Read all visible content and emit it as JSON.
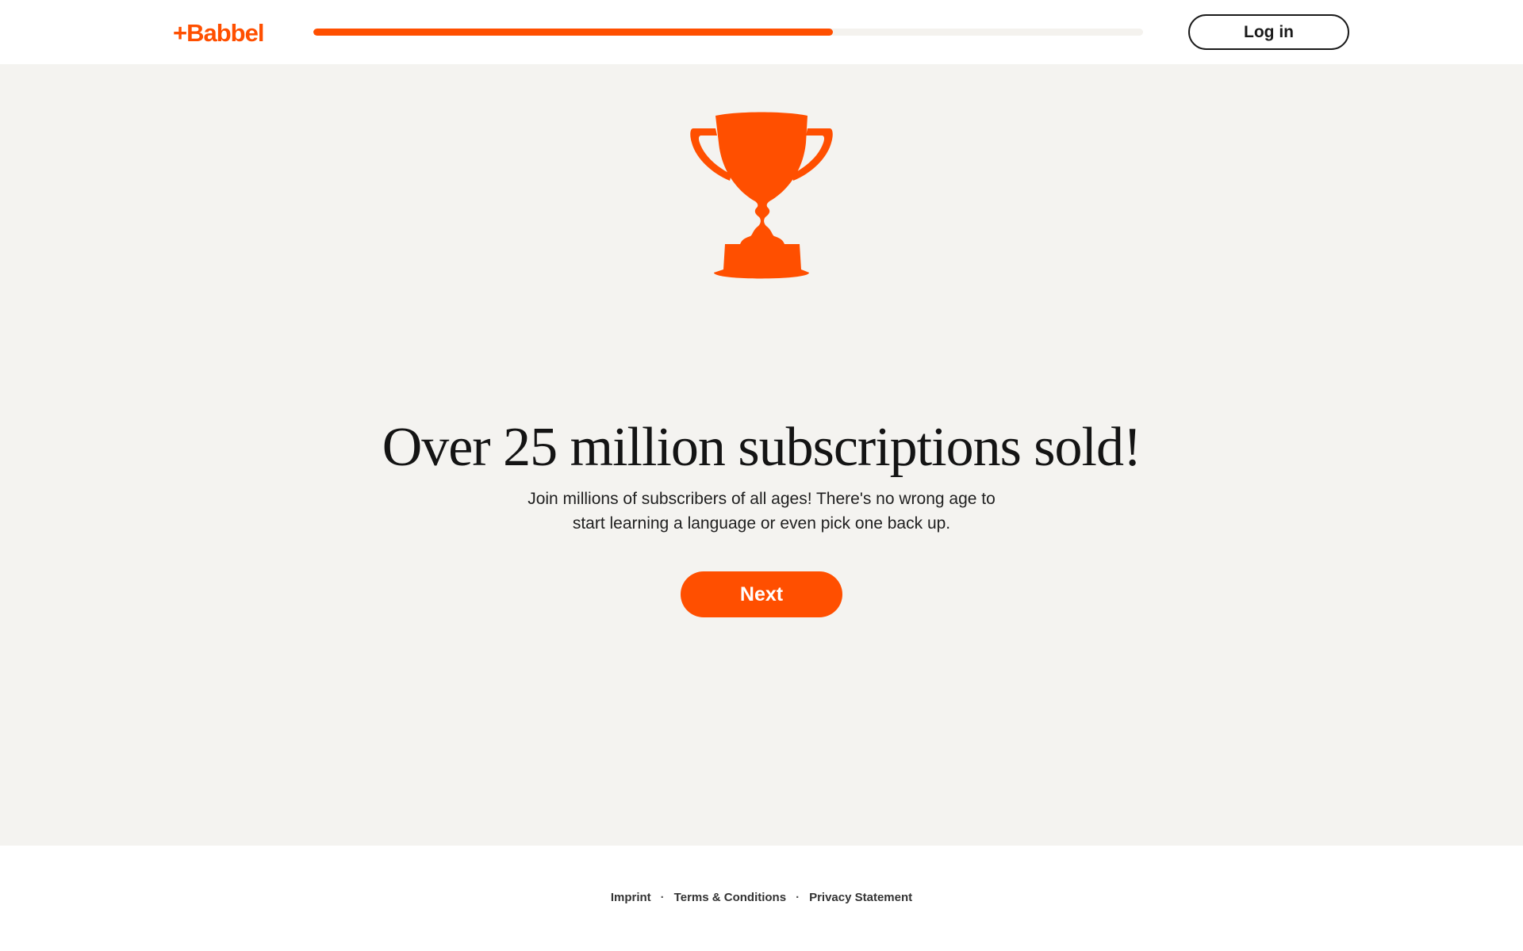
{
  "header": {
    "logo_text": "+Babbel",
    "progress_fraction": 0.626,
    "login_label": "Log in"
  },
  "main": {
    "hero_icon": "trophy-icon",
    "title": "Over 25 million subscriptions sold!",
    "subtitle_line1": "Join millions of subscribers of all ages! There's no wrong age to",
    "subtitle_line2": "start learning a language or even pick one back up.",
    "next_label": "Next"
  },
  "footer": {
    "links": [
      "Imprint",
      "Terms & Conditions",
      "Privacy Statement"
    ],
    "separator": "·"
  },
  "colors": {
    "brand": "#ff4f00",
    "background": "#f4f3f0",
    "text": "#141414"
  }
}
